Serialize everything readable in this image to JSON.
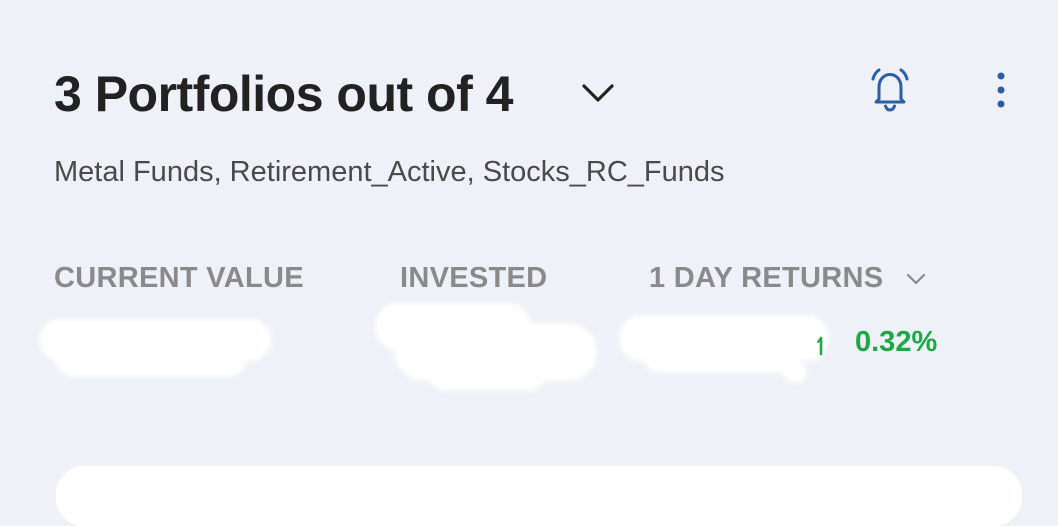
{
  "header": {
    "title": "3 Portfolios out of 4",
    "dropdown_icon": "chevron-down-icon",
    "notification_icon": "bell-icon",
    "menu_icon": "more-vertical-icon"
  },
  "portfolios_subtitle": "Metal Funds, Retirement_Active, Stocks_RC_Funds",
  "stats": {
    "current_value_label": "CURRENT VALUE",
    "invested_label": "INVESTED",
    "returns_label": "1 DAY RETURNS",
    "returns_dropdown_icon": "chevron-down-icon",
    "returns_percent": "0.32%",
    "returns_trend_icon": "arrow-up-icon"
  },
  "colors": {
    "background": "#eef1f7",
    "accent": "#2a5ea8",
    "positive": "#1fa745",
    "label_gray": "#8a8a8a"
  }
}
